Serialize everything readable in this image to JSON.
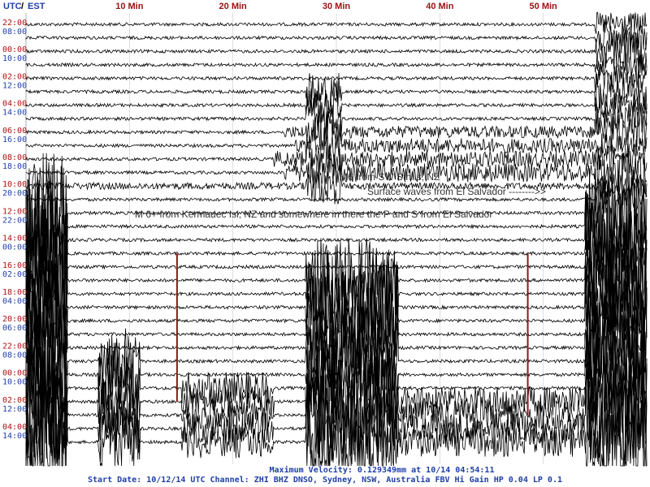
{
  "header": {
    "utc": "UTC",
    "sep": "/",
    "est": "EST"
  },
  "chart_data": {
    "type": "line",
    "title": "",
    "x_unit": "minutes",
    "xlim": [
      0,
      60
    ],
    "minute_ticks": [
      {
        "minute": 10,
        "label": "10 Min"
      },
      {
        "minute": 20,
        "label": "20 Min"
      },
      {
        "minute": 30,
        "label": "30 Min"
      },
      {
        "minute": 40,
        "label": "40 Min"
      },
      {
        "minute": 50,
        "label": "50 Min"
      }
    ],
    "hour_labels": [
      {
        "utc": "22:00",
        "est": "08:00"
      },
      {
        "utc": "00:00",
        "est": "10:00"
      },
      {
        "utc": "02:00",
        "est": "12:00"
      },
      {
        "utc": "04:00",
        "est": "14:00"
      },
      {
        "utc": "06:00",
        "est": "16:00"
      },
      {
        "utc": "08:00",
        "est": "18:00"
      },
      {
        "utc": "10:00",
        "est": "20:00"
      },
      {
        "utc": "12:00",
        "est": "22:00"
      },
      {
        "utc": "14:00",
        "est": "00:00"
      },
      {
        "utc": "16:00",
        "est": "02:00"
      },
      {
        "utc": "18:00",
        "est": "04:00"
      },
      {
        "utc": "20:00",
        "est": "06:00"
      },
      {
        "utc": "22:00",
        "est": "08:00"
      },
      {
        "utc": "00:00",
        "est": "10:00"
      },
      {
        "utc": "02:00",
        "est": "12:00"
      },
      {
        "utc": "04:00",
        "est": "14:00"
      }
    ],
    "trace_count": 32,
    "trace_color": "#000000",
    "marker_color": "#8b1a1a",
    "label_utc_color": "#b01010",
    "label_est_color": "#1f3fa8",
    "events": [
      {
        "trace": 8,
        "minute": 25,
        "end_minute": 60,
        "amp": 0.45
      },
      {
        "trace": 9,
        "minute": 26,
        "end_minute": 60,
        "amp": 0.55
      },
      {
        "trace": 10,
        "minute": 24,
        "end_minute": 60,
        "amp": 0.6
      },
      {
        "trace": 11,
        "minute": 25,
        "end_minute": 60,
        "amp": 0.7
      },
      {
        "trace": 12,
        "minute": 0,
        "end_minute": 60,
        "amp": 0.25
      }
    ],
    "markers": [
      {
        "minute": 14.6,
        "trace_start": 17,
        "trace_end": 28
      },
      {
        "minute": 48.5,
        "trace_start": 17,
        "trace_end": 29
      }
    ],
    "annotations": [
      {
        "text": "M6 from SW Sth Is, NZ"
      },
      {
        "text": "Surface waves from El Salvador -------->>"
      },
      {
        "text": "M 6+ from Kermadec Isl, NZ  and somewhere in there the P and S from El Salvador"
      }
    ]
  },
  "footer": {
    "line1": "Maximum Velocity: 0.129349mm at 10/14 04:54:11",
    "line2": "Start Date: 10/12/14 UTC Channel: ZHI  BHZ  DNSO, Sydney, NSW, Australia  FBV Hi Gain HP 0.04 LP 0.1"
  }
}
